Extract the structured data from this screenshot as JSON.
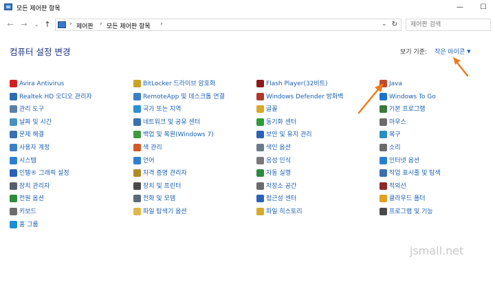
{
  "window": {
    "title": "모든 제어판 항목",
    "controls": {
      "minimize": "—",
      "maximize": "☐"
    }
  },
  "nav": {
    "back": "←",
    "forward": "→",
    "history": "⌄",
    "up": "↑",
    "breadcrumb": [
      "제어판",
      "모든 제어판 항목"
    ],
    "refresh": "↻",
    "search_placeholder": "제어판 검색"
  },
  "heading": "컴퓨터 설정 변경",
  "view_by": {
    "label": "보기 기준:",
    "value": "작은 아이콘"
  },
  "columns": [
    [
      {
        "label": "Avira Antivirus",
        "icon": "avira-icon",
        "color": "#d21f1f"
      },
      {
        "label": "Realtek HD 오디오 관리자",
        "icon": "speaker-icon",
        "color": "#2b6cb0"
      },
      {
        "label": "관리 도구",
        "icon": "admin-tools-icon",
        "color": "#5a7fa8"
      },
      {
        "label": "날짜 및 시간",
        "icon": "clock-icon",
        "color": "#4a90c2"
      },
      {
        "label": "문제 해결",
        "icon": "troubleshoot-icon",
        "color": "#3a6fb0"
      },
      {
        "label": "사용자 계정",
        "icon": "user-accounts-icon",
        "color": "#3b7fc4"
      },
      {
        "label": "시스템",
        "icon": "system-icon",
        "color": "#2f7fd0"
      },
      {
        "label": "인텔® 그래픽 설정",
        "icon": "intel-graphics-icon",
        "color": "#2a62b8"
      },
      {
        "label": "장치 관리자",
        "icon": "device-manager-icon",
        "color": "#555f6b"
      },
      {
        "label": "전원 옵션",
        "icon": "power-icon",
        "color": "#2e8b3a"
      },
      {
        "label": "키보드",
        "icon": "keyboard-icon",
        "color": "#6b6b6b"
      },
      {
        "label": "홈 그룹",
        "icon": "homegroup-icon",
        "color": "#1a8fd4"
      }
    ],
    [
      {
        "label": "BitLocker 드라이브 암호화",
        "icon": "bitlocker-icon",
        "color": "#c9a227"
      },
      {
        "label": "RemoteApp 및 데스크톱 연결",
        "icon": "remoteapp-icon",
        "color": "#3b7fc4"
      },
      {
        "label": "국가 또는 지역",
        "icon": "region-icon",
        "color": "#2f8fcf"
      },
      {
        "label": "네트워크 및 공유 센터",
        "icon": "network-icon",
        "color": "#3a6fb0"
      },
      {
        "label": "백업 및 복원(Windows 7)",
        "icon": "backup-icon",
        "color": "#3e9a3e"
      },
      {
        "label": "색 관리",
        "icon": "color-management-icon",
        "color": "#d05a2a"
      },
      {
        "label": "언어",
        "icon": "language-icon",
        "color": "#2f7fd0"
      },
      {
        "label": "자격 증명 관리자",
        "icon": "credential-icon",
        "color": "#b08a2a"
      },
      {
        "label": "장치 및 프린터",
        "icon": "printer-icon",
        "color": "#4a4a4a"
      },
      {
        "label": "전화 및 모뎀",
        "icon": "phone-modem-icon",
        "color": "#5b6b7a"
      },
      {
        "label": "파일 탐색기 옵션",
        "icon": "folder-options-icon",
        "color": "#e0b84a"
      }
    ],
    [
      {
        "label": "Flash Player(32비트)",
        "icon": "flash-icon",
        "color": "#8b1a1a"
      },
      {
        "label": "Windows Defender 방화벽",
        "icon": "firewall-icon",
        "color": "#b03a2a"
      },
      {
        "label": "글꼴",
        "icon": "fonts-icon",
        "color": "#d9a92c"
      },
      {
        "label": "동기화 센터",
        "icon": "sync-icon",
        "color": "#2e9a3a"
      },
      {
        "label": "보안 및 유지 관리",
        "icon": "security-flag-icon",
        "color": "#2a62b8"
      },
      {
        "label": "색인 옵션",
        "icon": "indexing-icon",
        "color": "#6b7b8b"
      },
      {
        "label": "음성 인식",
        "icon": "microphone-icon",
        "color": "#7a7a7a"
      },
      {
        "label": "자동 실행",
        "icon": "autoplay-icon",
        "color": "#2f8a3f"
      },
      {
        "label": "저장소 공간",
        "icon": "storage-icon",
        "color": "#6b6b6b"
      },
      {
        "label": "접근성 센터",
        "icon": "ease-of-access-icon",
        "color": "#2a62b8"
      },
      {
        "label": "파일 히스토리",
        "icon": "file-history-icon",
        "color": "#d9a92c"
      }
    ],
    [
      {
        "label": "Java",
        "icon": "java-icon",
        "color": "#c04a2a"
      },
      {
        "label": "Windows To Go",
        "icon": "windows-to-go-icon",
        "color": "#1a73d0"
      },
      {
        "label": "기본 프로그램",
        "icon": "default-programs-icon",
        "color": "#3a7a3a"
      },
      {
        "label": "마우스",
        "icon": "mouse-icon",
        "color": "#6b6b6b"
      },
      {
        "label": "복구",
        "icon": "recovery-icon",
        "color": "#2a8fbf"
      },
      {
        "label": "소리",
        "icon": "sound-icon",
        "color": "#6b6b6b"
      },
      {
        "label": "인터넷 옵션",
        "icon": "internet-options-icon",
        "color": "#2a7fd0"
      },
      {
        "label": "작업 표시줄 및 탐색",
        "icon": "taskbar-icon",
        "color": "#3a6fb0"
      },
      {
        "label": "적외선",
        "icon": "infrared-icon",
        "color": "#8a2a2a"
      },
      {
        "label": "클라우드 폴더",
        "icon": "work-folders-icon",
        "color": "#e0a020"
      },
      {
        "label": "프로그램 및 기능",
        "icon": "programs-features-icon",
        "color": "#4a4a4a"
      }
    ]
  ],
  "annotation_color": "#f07a1e",
  "watermark": "jsmall.net"
}
